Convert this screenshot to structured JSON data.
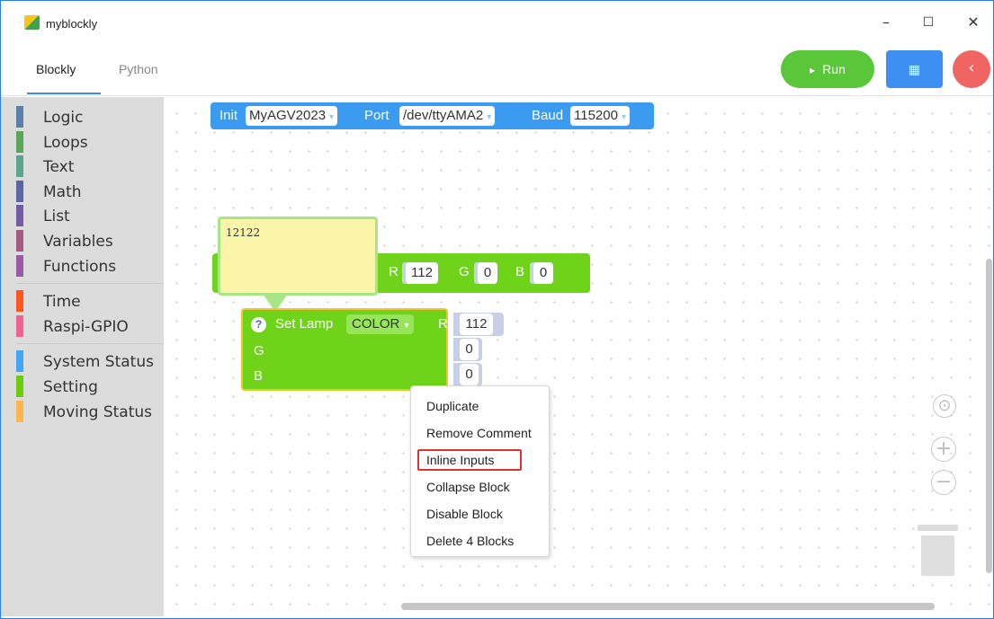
{
  "window": {
    "title": "myblockly",
    "minimize": "–",
    "maximize": "☐",
    "close": "✕"
  },
  "tabs": [
    {
      "label": "Blockly",
      "active": true
    },
    {
      "label": "Python",
      "active": false
    }
  ],
  "toolbar": {
    "run_label": "Run",
    "run_icon": "▸",
    "grid_icon": "▦",
    "back_icon": "‹"
  },
  "toolbox": {
    "categories": [
      {
        "label": "Logic",
        "color": "#5b80a5"
      },
      {
        "label": "Loops",
        "color": "#5ba55b"
      },
      {
        "label": "Text",
        "color": "#5ba58c"
      },
      {
        "label": "Math",
        "color": "#5b67a5"
      },
      {
        "label": "List",
        "color": "#745ba5"
      },
      {
        "label": "Variables",
        "color": "#a55b80"
      },
      {
        "label": "Functions",
        "color": "#995ba5"
      },
      {
        "label": "Time",
        "color": "#ff5722"
      },
      {
        "label": "Raspi-GPIO",
        "color": "#f06292"
      },
      {
        "label": "System Status",
        "color": "#42a5f5"
      },
      {
        "label": "Setting",
        "color": "#6ccc10"
      },
      {
        "label": "Moving Status",
        "color": "#ffb74d"
      }
    ]
  },
  "workspace": {
    "init_block": {
      "label": "Init",
      "robot": "MyAGV2023",
      "port_label": "Port",
      "port": "/dev/ttyAMA2",
      "baud_label": "Baud",
      "baud": "115200"
    },
    "bg_lamp_block": {
      "r_label": "R",
      "r": "112",
      "g_label": "G",
      "g": "0",
      "b_label": "B",
      "b": "0"
    },
    "comment": {
      "text": "12122"
    },
    "set_lamp_block": {
      "help": "?",
      "label": "Set Lamp",
      "mode": "COLOR",
      "r_label": "R",
      "r": "112",
      "g_label": "G",
      "g": "0",
      "b_label": "B",
      "b": "0"
    }
  },
  "context_menu": {
    "items": [
      "Duplicate",
      "Remove Comment",
      "Inline Inputs",
      "Collapse Block",
      "Disable Block",
      "Delete 4 Blocks"
    ],
    "highlighted": "Inline Inputs"
  },
  "controls": {
    "recenter_icon": "⊙",
    "zoom_in_icon": "+",
    "zoom_out_icon": "−"
  }
}
